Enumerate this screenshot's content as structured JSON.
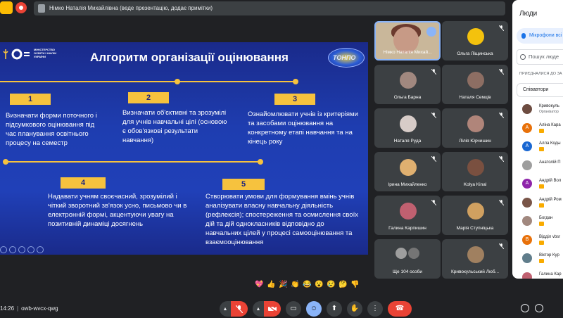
{
  "topbar": {
    "presenter_label": "Німко Наталія Михайлівна (веде презентацію, додає примітки)"
  },
  "slide": {
    "ministry_text": "МІНІСТЕРСТВО ОСВІТИ І НАУКИ УКРАЇНИ",
    "title": "Алгоритм організації оцінювання",
    "badge_text": "ТОНПО",
    "steps": [
      {
        "number": "1",
        "text": "Визначати форми  поточного і підсумкового оцінювання під час планування освітнього процесу на семестр"
      },
      {
        "number": "2",
        "text": "Визначати об'єктивні та зрозумілі для учнів навчальні цілі  (основою є обов'язкові результати навчання)"
      },
      {
        "number": "3",
        "text": "Ознайомлювати учнів із критеріями та засобами оцінювання на  конкретному етапі навчання та на кінець року"
      },
      {
        "number": "4",
        "text": "Надавати учням своєчасний, зрозумілий і чіткий зворотний зв'язок усно, письмово чи в електронній формі, акцентуючи увагу на позитивній динаміці досягнень"
      },
      {
        "number": "5",
        "text": "Створювати умови для формування вмінь учнів аналізувати власну навчальну діяльність (рефлексія); спостереження та осмислення своїх дій та дій однокласників відповідно до навчальних цілей у процесі самооцінювання та взаємооцінювання"
      }
    ]
  },
  "participants": [
    {
      "name": "Німко Наталія Михай...",
      "active": true,
      "color": "#c79a86"
    },
    {
      "name": "Ольга Ліщинська",
      "color": "#f4c20d"
    },
    {
      "name": "Ольга Барна",
      "color": "#a1887f"
    },
    {
      "name": "Наталя Семців",
      "color": "#8d6e63"
    },
    {
      "name": "Наталя Руда",
      "color": "#d7ccc8"
    },
    {
      "name": "Лілія Юрчишин",
      "color": "#b0857a"
    },
    {
      "name": "Ірина Михайленко",
      "color": "#e0b070"
    },
    {
      "name": "Kolya Kinal",
      "color": "#7a5040"
    },
    {
      "name": "Галина Карпишин",
      "color": "#c06070"
    },
    {
      "name": "Марія Ступніцька",
      "color": "#d0a060"
    },
    {
      "name": "Ще 104 особи",
      "color": "#9e9e9e"
    },
    {
      "name": "Кривокульський Люб...",
      "color": "#a08060"
    }
  ],
  "people_panel": {
    "title": "Люди",
    "mic_label": "Мікрофони всі",
    "search_placeholder": "Пошук люде",
    "section_label": "ПРИЄДНАЛИСЯ ДО ЗА",
    "group_label": "Співавтори",
    "people": [
      {
        "initial": "",
        "name": "Кривокуль",
        "sub": "Організатор",
        "color": "#6d4c41"
      },
      {
        "initial": "А",
        "name": "Аліна Кара",
        "color": "#e8710a"
      },
      {
        "initial": "А",
        "name": "Алла Коды",
        "color": "#1967d2"
      },
      {
        "initial": "",
        "name": "Анатолій П",
        "color": "#9e9e9e"
      },
      {
        "initial": "А",
        "name": "Андрій Вол",
        "color": "#8e24aa"
      },
      {
        "initial": "",
        "name": "Андрій Ром",
        "color": "#795548"
      },
      {
        "initial": "",
        "name": "Богдан",
        "color": "#a1887f"
      },
      {
        "initial": "В",
        "name": "Відділ vbsr",
        "color": "#e8710a"
      },
      {
        "initial": "",
        "name": "Віктор Кур",
        "color": "#607d8b"
      },
      {
        "initial": "",
        "name": "Галина Кар",
        "color": "#c06070"
      }
    ]
  },
  "bottom": {
    "time": "14:26",
    "meeting_code": "owb-wvcx-qwg",
    "reactions": [
      "💖",
      "👍",
      "🎉",
      "👏",
      "😂",
      "😮",
      "😢",
      "🤔",
      "👎"
    ]
  }
}
